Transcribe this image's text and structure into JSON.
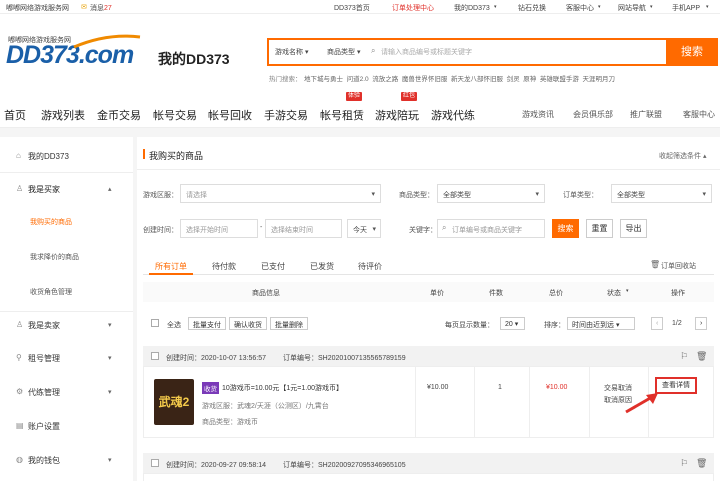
{
  "topbar": {
    "site": "嘟嘟网络游戏服务网",
    "message": "消息",
    "message_count": "27",
    "links": [
      "DD373首页",
      "订单处理中心",
      "我的DD373",
      "钻石兑换",
      "客服中心",
      "网站导航",
      "手机APP"
    ]
  },
  "header": {
    "logo_tagline": "嘟嘟网络游戏服务网",
    "logo_text": "DD373.com",
    "page_title": "我的DD373",
    "search": {
      "game_select": "游戏名称",
      "type_select": "商品类型",
      "placeholder": "请输入商品编号或标题关键字",
      "button": "搜索"
    },
    "hot_label": "热门搜索：",
    "hot_terms": [
      "地下城与勇士",
      "问道2.0",
      "流放之路",
      "魔兽世界怀旧服",
      "新天龙八部怀旧服",
      "剑灵",
      "原神",
      "英雄联盟手游",
      "天涯明月刀"
    ]
  },
  "nav": {
    "items": [
      "首页",
      "游戏列表",
      "金币交易",
      "帐号交易",
      "帐号回收",
      "手游交易",
      "帐号租赁",
      "游戏陪玩",
      "游戏代练"
    ],
    "badges": {
      "rent": "体验",
      "play": "红包"
    },
    "right": [
      "游戏资讯",
      "会员俱乐部",
      "推广联盟",
      "客服中心"
    ]
  },
  "sidebar": {
    "home": "我的DD373",
    "buyer": "我是买家",
    "buyer_subs": [
      "我购买的商品",
      "我求降价的商品",
      "收货角色管理"
    ],
    "seller": "我是卖家",
    "account": "租号管理",
    "proxy": "代练管理",
    "settings": "账户设置",
    "wallet": "我的钱包"
  },
  "main": {
    "title": "我购买的商品",
    "collapse": "收起筛选条件",
    "filters": {
      "area_label": "游戏区服：",
      "area_placeholder": "请选择",
      "type_label": "商品类型：",
      "type_value": "全部类型",
      "otype_label": "订单类型：",
      "otype_value": "全部类型",
      "time_label": "创建时间：",
      "start_placeholder": "选择开始时间",
      "end_placeholder": "选择结束时间",
      "days": "今天",
      "kw_label": "关键字：",
      "kw_placeholder": "订单编号或商品关键字",
      "search_btn": "搜索",
      "reset_btn": "重置",
      "export_btn": "导出"
    },
    "tabs": [
      "所有订单",
      "待付款",
      "已支付",
      "已发货",
      "待评价"
    ],
    "recycle": "订单回收站",
    "columns": [
      "商品信息",
      "单价",
      "件数",
      "总价",
      "状态",
      "操作"
    ],
    "bulk": {
      "select_all": "全选",
      "pay": "批量支付",
      "confirm": "确认收货",
      "delete": "批量删除",
      "per_page_label": "每页显示数量：",
      "per_page": "20",
      "sort_label": "排序：",
      "sort_value": "时间由近到远",
      "page": "1/2"
    },
    "orders": [
      {
        "created_label": "创建时间：",
        "created": "2020-10-07 13:56:57",
        "no_label": "订单编号：",
        "no": "SH20201007135565789159",
        "thumb": "武魂2",
        "tag": "收货",
        "title": "10游戏币=10.00元【1元=1.00游戏币】",
        "server": "游戏区服：武魂2/天涯（公测区）/九霄台",
        "type": "商品类型：游戏币",
        "price": "¥10.00",
        "qty": "1",
        "total": "¥10.00",
        "status": "交易取消",
        "status_link": "取消原因",
        "action": "查看详情"
      },
      {
        "created_label": "创建时间：",
        "created": "2020-09-27 09:58:14",
        "no_label": "订单编号：",
        "no": "SH20200927095346965105"
      }
    ]
  },
  "colors": {
    "accent": "#ff6a00",
    "red": "#e0302a",
    "logo_blue": "#1a5fa8"
  }
}
